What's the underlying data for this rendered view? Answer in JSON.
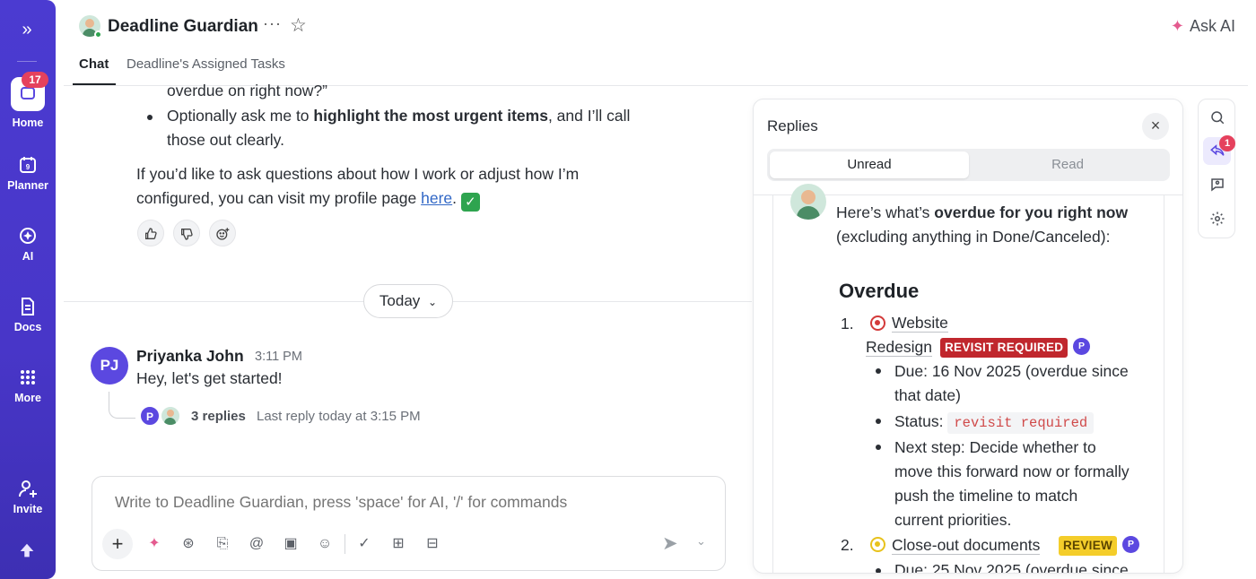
{
  "rail": {
    "expand_icon": "double-chevron-right-icon",
    "badge_count": "17",
    "items": [
      {
        "label": "Home",
        "icon": "home-icon"
      },
      {
        "label": "Planner",
        "icon": "calendar-icon"
      },
      {
        "label": "AI",
        "icon": "ai-icon"
      },
      {
        "label": "Docs",
        "icon": "docs-icon"
      },
      {
        "label": "More",
        "icon": "grid-icon"
      },
      {
        "label": "Invite",
        "icon": "invite-icon"
      }
    ]
  },
  "header": {
    "title": "Deadline Guardian",
    "ask_ai": "Ask AI",
    "tabs": [
      {
        "label": "Chat",
        "active": true
      },
      {
        "label": "Deadline's Assigned Tasks",
        "active": false
      }
    ]
  },
  "chat": {
    "line_cont": "overdue on right now?”",
    "bullet2_a": "Optionally ask me to ",
    "bullet2_b": "highlight the most urgent items",
    "bullet2_c": ", and I’ll call",
    "bullet2_d": "those out clearly.",
    "para_a": "If you’d like to ask questions about how I work or adjust how I’m",
    "para_b": "configured, you can visit my profile page ",
    "para_link": "here",
    "para_end": ".",
    "date_divider": "Today",
    "message": {
      "avatar_initials": "PJ",
      "author": "Priyanka John",
      "time": "3:11 PM",
      "text": "Hey, let's get started!",
      "reply_avatar_initial": "P",
      "replies": "3 replies",
      "last_reply": "Last reply today at 3:15 PM"
    },
    "composer": {
      "placeholder": "Write to Deadline Guardian, press 'space' for AI, '/' for commands"
    }
  },
  "replies_panel": {
    "title": "Replies",
    "tabs": [
      {
        "label": "Unread",
        "active": true
      },
      {
        "label": "Read",
        "active": false
      }
    ],
    "intro_a": "Here’s what’s ",
    "intro_b": "overdue for you right now",
    "intro_c": "(excluding anything in Done/Canceled):",
    "heading": "Overdue",
    "items": [
      {
        "num": "1.",
        "name_a": "Website",
        "name_b": "Redesign",
        "tag": "REVISIT REQUIRED",
        "assignee": "P",
        "due_a": "Due: 16 Nov 2025 (overdue since",
        "due_b": "that date)",
        "status_label": "Status: ",
        "status_code": "revisit required",
        "next_a": "Next step: Decide whether to",
        "next_b": "move this forward now or formally",
        "next_c": "push the timeline to match",
        "next_d": "current priorities."
      },
      {
        "num": "2.",
        "name": "Close-out documents",
        "tag": "REVIEW",
        "assignee": "P",
        "due": "Due: 25 Nov 2025 (overdue since"
      }
    ]
  },
  "colors": {
    "rail": "#4b3bd1",
    "accent": "#5b48e0",
    "tag_red": "#c0272d",
    "tag_yellow": "#f4cd2a",
    "badge": "#e5415d"
  }
}
